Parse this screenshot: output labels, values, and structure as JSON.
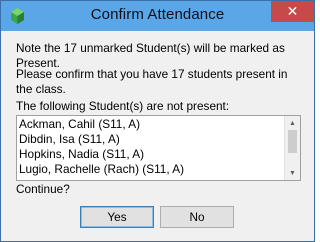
{
  "window": {
    "title": "Confirm Attendance",
    "close_glyph": "✕"
  },
  "message": {
    "line1": "Note the 17 unmarked Student(s) will be marked as Present.",
    "line2": "Please confirm that you have 17 students present in the class.",
    "list_heading": "The following Student(s) are not present:"
  },
  "students": [
    "Ackman, Cahil (S11, A)",
    "Dibdin, Isa (S11, A)",
    "Hopkins, Nadia (S11, A)",
    "Lugio, Rachelle (Rach) (S11, A)"
  ],
  "scrollbar": {
    "up_glyph": "▲",
    "down_glyph": "▼"
  },
  "prompt": "Continue?",
  "buttons": {
    "yes": "Yes",
    "no": "No"
  },
  "colors": {
    "titlebar": "#5aa6e6",
    "close_button": "#c74a4a",
    "dialog_bg": "#f0f0f0"
  }
}
